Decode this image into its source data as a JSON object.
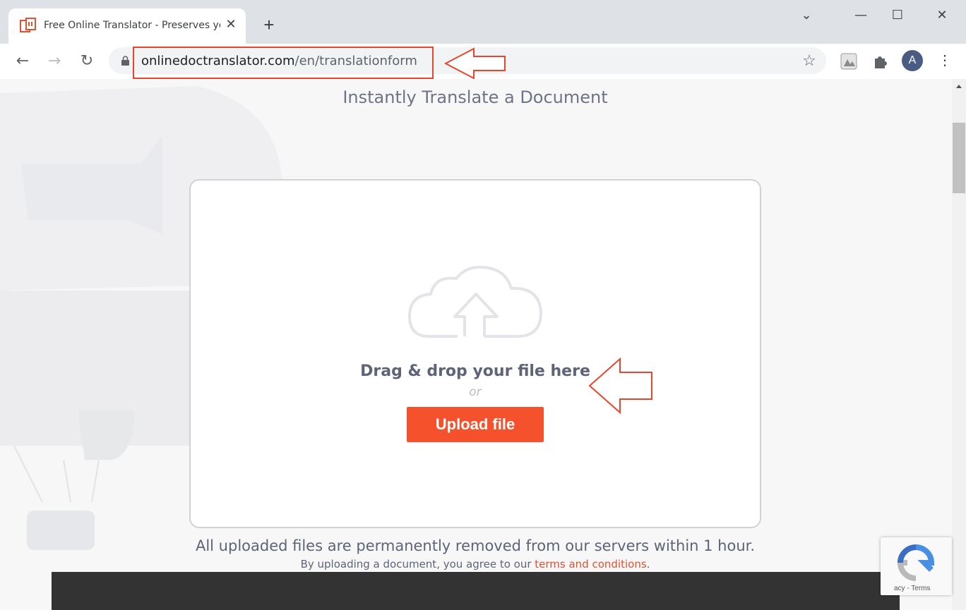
{
  "browser": {
    "tab_title": "Free Online Translator - Preserves yo",
    "tab_close": "✕",
    "new_tab": "+",
    "window_controls": {
      "dropdown": "⌄",
      "minimize": "—",
      "maximize": "☐",
      "close": "✕"
    },
    "nav": {
      "back": "←",
      "forward": "→",
      "reload": "↻"
    },
    "url_domain": "onlinedoctranslator.com",
    "url_path": "/en/translationform",
    "bookmark_star": "☆",
    "profile_initial": "A",
    "menu": "⋮"
  },
  "page": {
    "title": "Instantly Translate a Document",
    "drag_text": "Drag & drop your file here",
    "or_text": "or",
    "upload_label": "Upload file",
    "notice": "All uploaded files are permanently removed from our servers within 1 hour.",
    "terms_prefix": "By uploading a document, you agree to our ",
    "terms_link": "terms and conditions",
    "terms_suffix": "."
  },
  "recaptcha": {
    "text": "acy - Terms"
  },
  "colors": {
    "accent": "#f4512c",
    "annotation": "#e7462d",
    "tab_icon": "#e0512f"
  }
}
